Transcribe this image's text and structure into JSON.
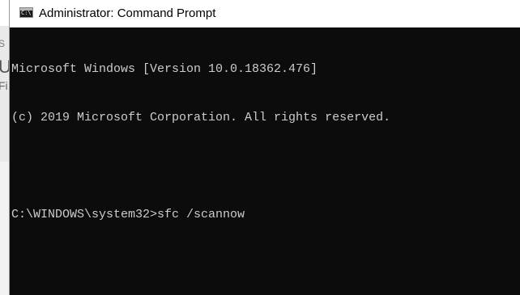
{
  "background_window": {
    "chars": [
      "S",
      "U",
      "Fi"
    ]
  },
  "window": {
    "icon": "cmd-app-icon",
    "icon_glyph": "C:\\",
    "title": "Administrator: Command Prompt"
  },
  "console": {
    "lines": [
      "Microsoft Windows [Version 10.0.18362.476]",
      "(c) 2019 Microsoft Corporation. All rights reserved.",
      "",
      "C:\\WINDOWS\\system32>sfc /scannow"
    ]
  },
  "colors": {
    "console_bg": "#0c0c0c",
    "console_text": "#cccccc",
    "titlebar_bg": "#ffffff"
  }
}
